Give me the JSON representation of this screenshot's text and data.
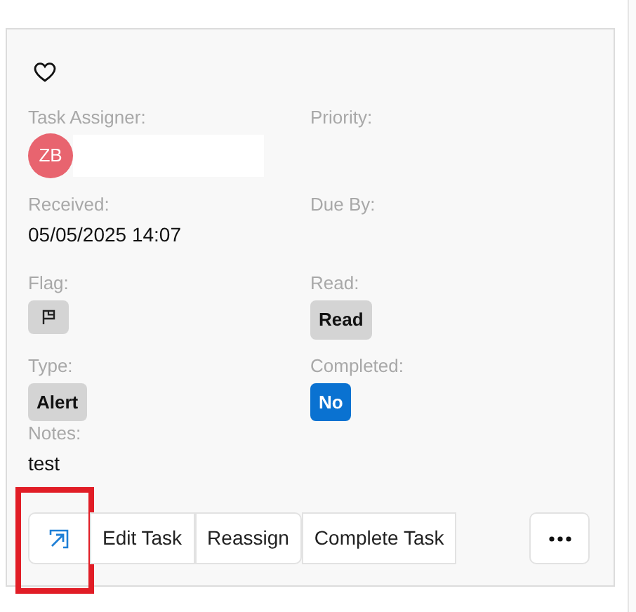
{
  "favorite": {
    "on": false
  },
  "fields": [
    {
      "label": "Task Assigner:",
      "kind": "avatar",
      "initials": "ZB"
    },
    {
      "label": "Priority:",
      "kind": "empty"
    },
    {
      "label": "Received:",
      "kind": "text",
      "value": "05/05/2025 14:07"
    },
    {
      "label": "Due By:",
      "kind": "empty"
    },
    {
      "label": "Flag:",
      "kind": "flag"
    },
    {
      "label": "Read:",
      "kind": "badge",
      "value": "Read",
      "color": "#d4d4d4"
    },
    {
      "label": "Type:",
      "kind": "badge",
      "value": "Alert",
      "color": "#d4d4d4"
    },
    {
      "label": "Completed:",
      "kind": "badge",
      "value": "No",
      "color": "#0a72d1"
    }
  ],
  "notes": {
    "label": "Notes:",
    "value": "test"
  },
  "actions": [
    {
      "kind": "icon",
      "highlighted": true
    },
    {
      "kind": "text",
      "label": "Edit Task",
      "highlighted": false
    },
    {
      "kind": "text",
      "label": "Reassign",
      "highlighted": false
    },
    {
      "kind": "text",
      "label": "Complete Task",
      "highlighted": false
    }
  ]
}
